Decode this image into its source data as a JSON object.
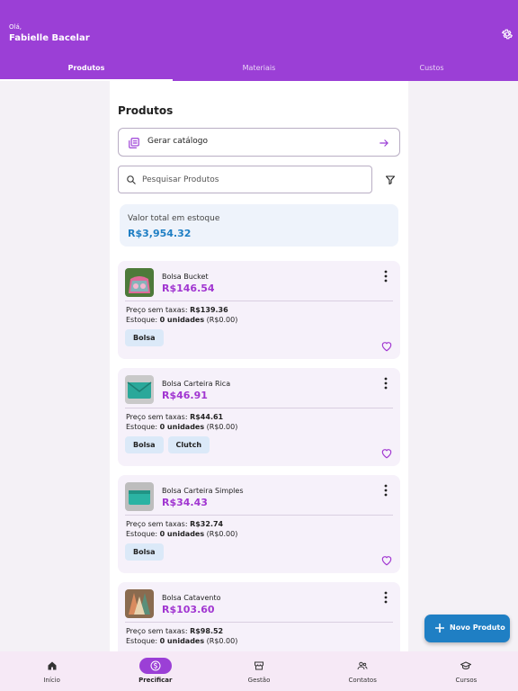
{
  "header": {
    "greeting": "Olá,",
    "user_name": "Fabielle Bacelar"
  },
  "tabs": [
    {
      "label": "Produtos",
      "active": true
    },
    {
      "label": "Materiais",
      "active": false
    },
    {
      "label": "Custos",
      "active": false
    }
  ],
  "main": {
    "title": "Produtos",
    "catalog_button": "Gerar catálogo",
    "search_placeholder": "Pesquisar Produtos",
    "stock_label": "Valor total em estoque",
    "stock_value": "R$3,954.32"
  },
  "labels": {
    "price_no_tax": "Preço sem taxas:",
    "stock": "Estoque:"
  },
  "products": [
    {
      "name": "Bolsa Bucket",
      "price": "R$146.54",
      "price_no_tax": "R$139.36",
      "stock_units": "0 unidades",
      "stock_value": "(R$0.00)",
      "tags": [
        "Bolsa"
      ]
    },
    {
      "name": "Bolsa Carteira Rica",
      "price": "R$46.91",
      "price_no_tax": "R$44.61",
      "stock_units": "0 unidades",
      "stock_value": "(R$0.00)",
      "tags": [
        "Bolsa",
        "Clutch"
      ]
    },
    {
      "name": "Bolsa Carteira Simples",
      "price": "R$34.43",
      "price_no_tax": "R$32.74",
      "stock_units": "0 unidades",
      "stock_value": "(R$0.00)",
      "tags": [
        "Bolsa"
      ]
    },
    {
      "name": "Bolsa Catavento",
      "price": "R$103.60",
      "price_no_tax": "R$98.52",
      "stock_units": "0 unidades",
      "stock_value": "(R$0.00)",
      "tags": []
    }
  ],
  "fab": {
    "label": "Novo Produto"
  },
  "bottom_nav": [
    {
      "label": "Início",
      "icon": "home-icon",
      "active": false
    },
    {
      "label": "Precificar",
      "icon": "dollar-circle-icon",
      "active": true
    },
    {
      "label": "Gestão",
      "icon": "store-icon",
      "active": false
    },
    {
      "label": "Contatos",
      "icon": "contacts-icon",
      "active": false
    },
    {
      "label": "Cursos",
      "icon": "graduation-cap-icon",
      "active": false
    }
  ],
  "colors": {
    "brand": "#9b3fd6",
    "price": "#a136d1",
    "accent_blue": "#1f7fc4"
  }
}
